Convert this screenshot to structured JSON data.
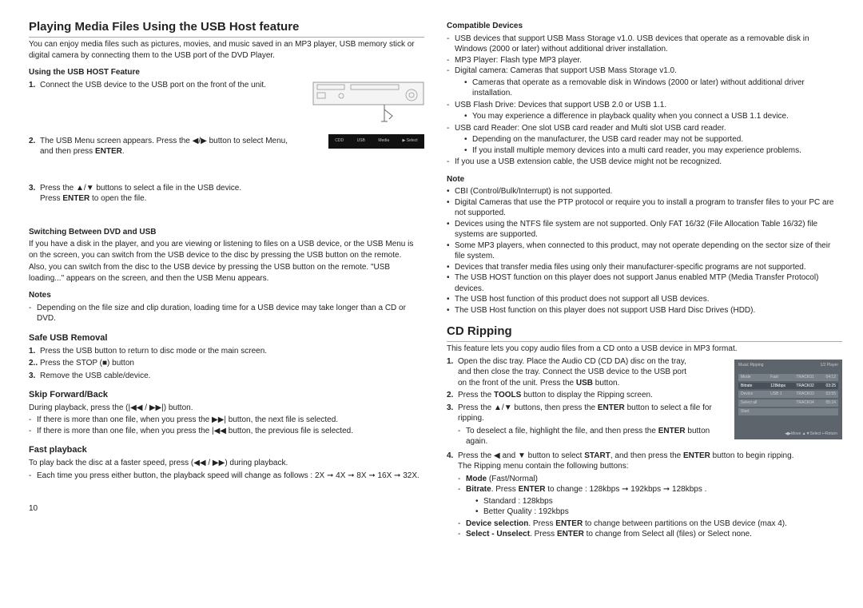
{
  "page_number": "10",
  "left": {
    "title": "Playing Media Files Using the USB Host feature",
    "intro": "You can enjoy media files such as pictures, movies, and music saved in an MP3 player, USB memory stick or digital camera by connecting them to the USB port of the DVD Player.",
    "usb_host_heading": "Using the USB HOST Feature",
    "step1": "Connect the USB device to the USB port on the front of the unit.",
    "step2a": "The USB Menu screen appears. Press the ◀/▶ button to select Menu,",
    "step2b": "and then press ",
    "step2_enter": "ENTER",
    "step2_end": ".",
    "step3a": "Press the ▲/▼ buttons to select a file in the USB device.",
    "step3b": "Press ",
    "step3_enter": "ENTER",
    "step3_end": " to open the file.",
    "switch_heading": "Switching Between DVD and USB",
    "switch_p1": "If you have a disk in the player, and you are viewing or listening to files on a USB device, or the USB Menu is on the screen, you can switch from the USB device to the disc by pressing the USB button on the remote.",
    "switch_p2": "Also, you can switch from the disc to the USB device by pressing the USB button on the remote. \"USB loading...\" appears on the screen, and then the USB Menu appears.",
    "notes_heading": "Notes",
    "notes_item": "Depending on the file size and clip duration, loading time for a USB device may take longer than a CD or DVD.",
    "safe_heading": "Safe USB Removal",
    "safe1": "Press the USB button to return to disc mode or the main screen.",
    "safe2a": "Press the STOP (",
    "safe2b": ") button",
    "safe3": "Remove the USB cable/device.",
    "skip_heading": "Skip Forward/Back",
    "skip_p": "During playback, press the (|◀◀ / ▶▶|) button.",
    "skip_li1": "If there is more than one file, when you press the ▶▶| button, the next file is selected.",
    "skip_li2": "If there is more than one file, when you press the |◀◀ button, the previous file is selected.",
    "fast_heading": "Fast playback",
    "fast_p": "To play back the disc at a faster speed, press (◀◀ / ▶▶) during playback.",
    "fast_li": "Each time you press either button, the playback speed will change as follows : 2X ➞ 4X ➞ 8X ➞ 16X ➞ 32X."
  },
  "right": {
    "compat_heading": "Compatible Devices",
    "compat1": "USB devices that support USB Mass Storage v1.0. USB devices that operate as a removable disk in Windows (2000 or later) without additional driver installation.",
    "compat2": "MP3 Player: Flash type MP3 player.",
    "compat3": "Digital camera: Cameras that support USB Mass Storage v1.0.",
    "compat3_sub": "Cameras that operate as a removable disk in Windows (2000 or later) without additional driver installation.",
    "compat4": "USB Flash Drive: Devices that support USB 2.0 or USB 1.1.",
    "compat4_sub": "You may experience a difference in playback quality when you connect a USB 1.1 device.",
    "compat5": "USB card Reader: One slot USB card reader and Multi slot USB card reader.",
    "compat5_sub1": "Depending on the manufacturer, the USB card reader may not be supported.",
    "compat5_sub2": "If you install multiple memory devices into a multi card reader, you may experience problems.",
    "compat6": "If you use a USB extension cable, the USB device might not be recognized.",
    "note_heading": "Note",
    "note1": "CBI (Control/Bulk/Interrupt) is not supported.",
    "note2": "Digital Cameras that use the PTP protocol or require you to install a program to transfer files to your PC are not supported.",
    "note3": "Devices using the NTFS file system are not supported. Only FAT 16/32 (File Allocation  Table 16/32) file systems are supported.",
    "note4": "Some MP3 players, when connected to this product, may not operate depending on the sector size of their file system.",
    "note5": "Devices that transfer media files using only their manufacturer-specific programs are not supported.",
    "note6": "The USB HOST function on this player does not support Janus enabled MTP (Media Transfer Protocol) devices.",
    "note7": "The USB host function of this product does not support all USB devices.",
    "note8": "The USB Host function on this player does not support USB Hard Disc Drives (HDD).",
    "cd_title": "CD Ripping",
    "cd_intro": "This feature lets you copy audio files from a CD onto a USB device in MP3 format.",
    "cd1a": "Open the disc tray. Place the Audio CD (CD DA) disc on the tray,",
    "cd1b": "and then close the tray. Connect the USB device to the USB port",
    "cd1c_a": "on the front of the unit. Press the ",
    "cd1c_b": "USB",
    "cd1c_c": " button.",
    "cd2a": "Press the ",
    "cd2b": "TOOLS",
    "cd2c": " button to display the Ripping screen.",
    "cd3a": "Press the ▲/▼ buttons, then press the ",
    "cd3b": "ENTER",
    "cd3c": " button to select a file for ripping.",
    "cd3_sub_a": "To deselect a file, highlight the file, and then press the ",
    "cd3_sub_b": "ENTER",
    "cd3_sub_c": " button again.",
    "cd4a": "Press the ◀ and ▼ button to select ",
    "cd4b": "START",
    "cd4c": ", and then press the ",
    "cd4d": "ENTER",
    "cd4e": " button to begin ripping.",
    "cd4_p": "The Ripping menu contain the following buttons:",
    "mode_lbl": "Mode",
    "mode_val": " (Fast/Normal)",
    "bitrate_lbl": "Bitrate",
    "bitrate_val": ". Press ",
    "bitrate_enter": "ENTER",
    "bitrate_txt": " to change : 128kbps ➞ 192kbps ➞ 128kbps .",
    "bitrate_sub1": "Standard : 128kbps",
    "bitrate_sub2": "Better Quality : 192kbps",
    "devsel_lbl": "Device selection",
    "devsel_a": ". Press ",
    "devsel_b": "ENTER",
    "devsel_c": " to change between partitions on the USB device (max 4).",
    "sel_lbl": "Select - Unselect",
    "sel_a": ". Press ",
    "sel_b": "ENTER",
    "sel_c": " to change from Select all (files) or Select none."
  },
  "figs": {
    "menu_items": [
      "CDD",
      "USB",
      "Media",
      "▶ Select"
    ],
    "rip_header_left": "Music   Ripping",
    "rip_header_right": "1/2   Player",
    "rip_rows": [
      {
        "a": "Mode",
        "b": "Fast",
        "c": "TRACK01",
        "d": "04:12"
      },
      {
        "a": "Bitrate",
        "b": "128kbps",
        "c": "TRACK02",
        "d": "03:25"
      },
      {
        "a": "Device",
        "b": "USB 1",
        "c": "TRACK03",
        "d": "03:55"
      },
      {
        "a": "Select all",
        "b": "",
        "c": "TRACK04",
        "d": "05:24"
      },
      {
        "a": "Start",
        "b": "",
        "c": "",
        "d": ""
      }
    ],
    "rip_footer": "◀▶Move   ▲▼Select   ↩Return"
  }
}
